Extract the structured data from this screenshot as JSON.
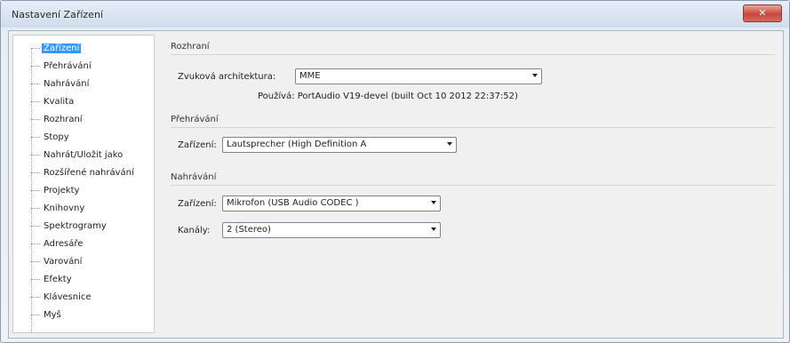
{
  "window": {
    "title": "Nastavení Zařízení",
    "close_label": "✕"
  },
  "sidebar": {
    "items": [
      {
        "label": "Zařízení"
      },
      {
        "label": "Přehrávání"
      },
      {
        "label": "Nahrávání"
      },
      {
        "label": "Kvalita"
      },
      {
        "label": "Rozhraní"
      },
      {
        "label": "Stopy"
      },
      {
        "label": "Nahrát/Uložit jako"
      },
      {
        "label": "Rozšířené nahrávání"
      },
      {
        "label": "Projekty"
      },
      {
        "label": "Knihovny"
      },
      {
        "label": "Spektrogramy"
      },
      {
        "label": "Adresáře"
      },
      {
        "label": "Varování"
      },
      {
        "label": "Efekty"
      },
      {
        "label": "Klávesnice"
      },
      {
        "label": "Myš"
      }
    ]
  },
  "interface": {
    "group_title": "Rozhraní",
    "host_label": "Zvuková architektura:",
    "host_value": "MME",
    "using_text": "Používá: PortAudio V19-devel (built Oct 10 2012 22:37:52)"
  },
  "playback": {
    "group_title": "Přehrávání",
    "device_label": "Zařízení:",
    "device_value": "Lautsprecher (High Definition A"
  },
  "recording": {
    "group_title": "Nahrávání",
    "device_label": "Zařízení:",
    "device_value": "Mikrofon (USB Audio CODEC )",
    "channels_label": "Kanály:",
    "channels_value": "2 (Stereo)"
  }
}
